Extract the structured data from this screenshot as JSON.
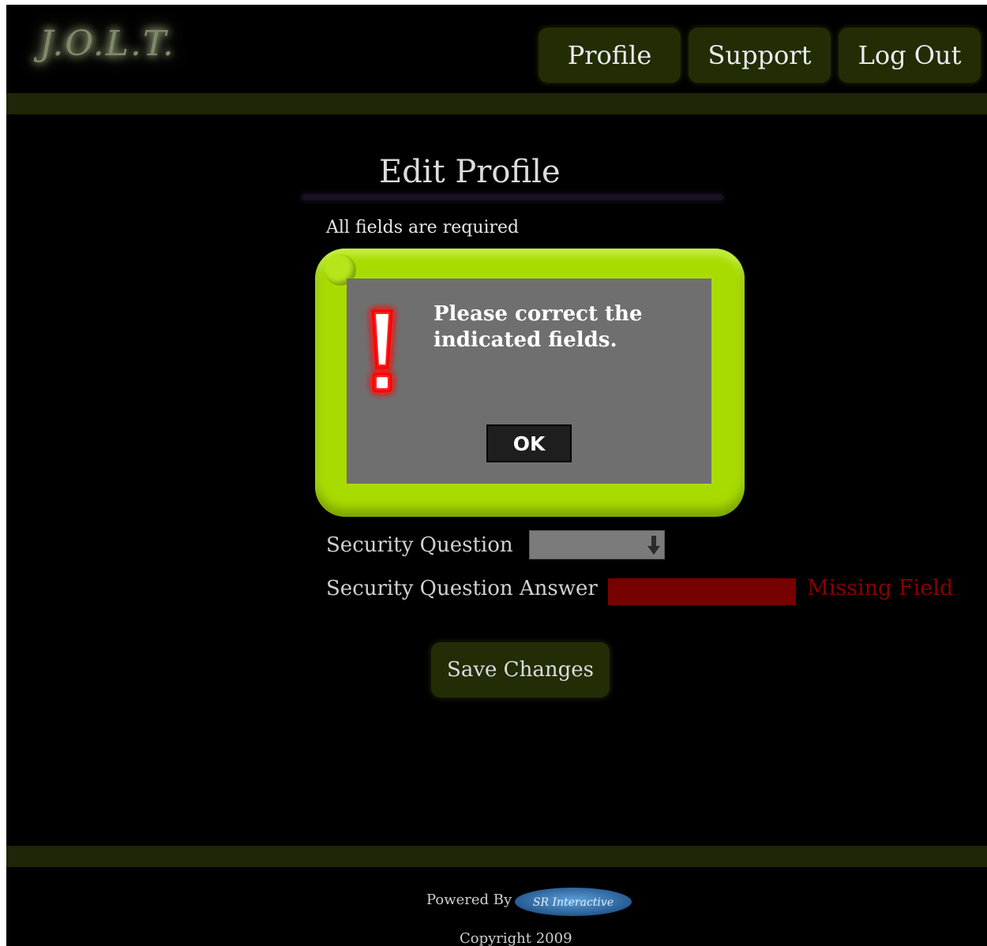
{
  "brand": {
    "logo_text": "J.O.L.T."
  },
  "nav": {
    "profile_label": "Profile",
    "support_label": "Support",
    "logout_label": "Log Out"
  },
  "page": {
    "title": "Edit Profile",
    "required_note": "All fields are required"
  },
  "dialog": {
    "message": "Please correct the indicated fields.",
    "ok_label": "OK",
    "icon": "exclamation-icon"
  },
  "form": {
    "security_question_label": "Security Question",
    "security_question_value": "",
    "security_answer_label": "Security Question Answer",
    "security_answer_value": "",
    "missing_field_text": "Missing Field",
    "save_label": "Save Changes"
  },
  "footer": {
    "powered_by": "Powered By",
    "partner_logo_text": "SR Interactive",
    "copyright": "Copyright 2009"
  },
  "colors": {
    "background": "#000000",
    "bar": "#1d2606",
    "button": "#222d06",
    "dialog_frame": "#a8dc00",
    "dialog_body": "#6f6f6f",
    "error_input": "#770000",
    "error_text": "#8a0000",
    "warning_icon": "#ff0000"
  }
}
